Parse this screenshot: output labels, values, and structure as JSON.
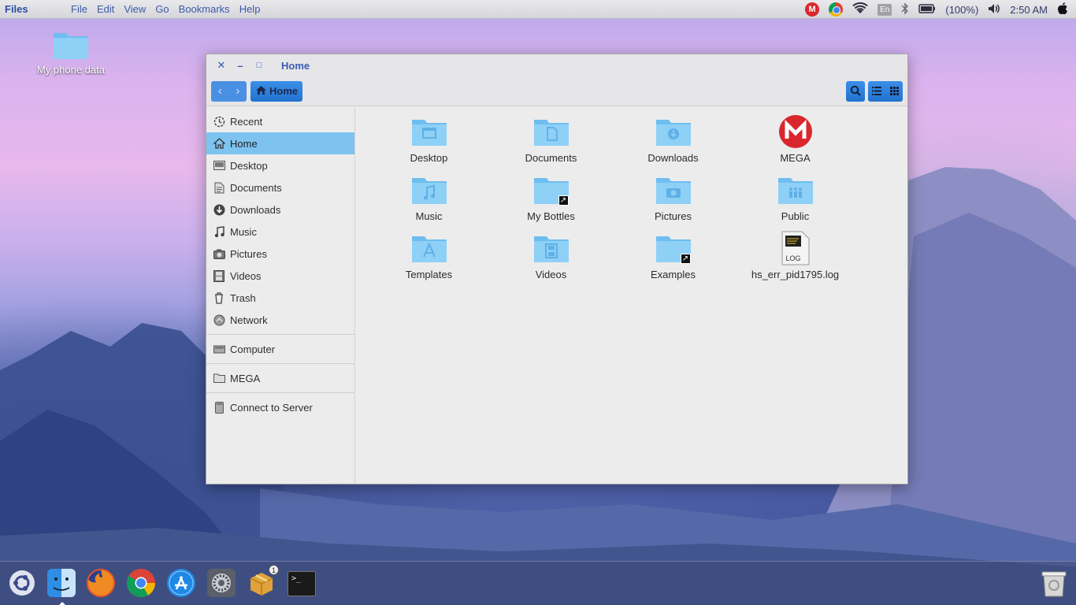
{
  "top_panel": {
    "app_name": "Files",
    "menus": [
      "File",
      "Edit",
      "View",
      "Go",
      "Bookmarks",
      "Help"
    ],
    "tray": {
      "mega_icon": "mega-icon",
      "chrome_icon": "chrome-icon",
      "wifi_icon": "wifi-icon",
      "language": "En",
      "bluetooth_icon": "bluetooth-icon",
      "battery_icon": "battery-icon",
      "battery_text": "(100%)",
      "volume_icon": "volume-icon",
      "clock": "2:50 AM",
      "apple_icon": "apple-icon"
    }
  },
  "desktop": {
    "icons": [
      {
        "label": "My phone data",
        "icon": "folder-icon"
      }
    ]
  },
  "window": {
    "title": "Home",
    "close": "✕",
    "minimize": "–",
    "maximize": "□",
    "breadcrumb": "Home",
    "sidebar": {
      "items": [
        {
          "label": "Recent",
          "icon": "recent-icon"
        },
        {
          "label": "Home",
          "icon": "home-icon",
          "active": true
        },
        {
          "label": "Desktop",
          "icon": "desktop-icon"
        },
        {
          "label": "Documents",
          "icon": "documents-icon"
        },
        {
          "label": "Downloads",
          "icon": "downloads-icon"
        },
        {
          "label": "Music",
          "icon": "music-icon"
        },
        {
          "label": "Pictures",
          "icon": "pictures-icon"
        },
        {
          "label": "Videos",
          "icon": "videos-icon"
        },
        {
          "label": "Trash",
          "icon": "trash-icon"
        },
        {
          "label": "Network",
          "icon": "network-icon"
        }
      ],
      "devices": [
        {
          "label": "Computer",
          "icon": "computer-icon"
        }
      ],
      "bookmarks": [
        {
          "label": "MEGA",
          "icon": "folder-icon"
        }
      ],
      "network": [
        {
          "label": "Connect to Server",
          "icon": "server-icon"
        }
      ]
    },
    "files": [
      {
        "label": "Desktop",
        "icon": "desktop-folder-icon"
      },
      {
        "label": "Documents",
        "icon": "documents-folder-icon"
      },
      {
        "label": "Downloads",
        "icon": "downloads-folder-icon"
      },
      {
        "label": "MEGA",
        "icon": "mega-icon"
      },
      {
        "label": "Music",
        "icon": "music-folder-icon"
      },
      {
        "label": "My Bottles",
        "icon": "folder-link-icon"
      },
      {
        "label": "Pictures",
        "icon": "pictures-folder-icon"
      },
      {
        "label": "Public",
        "icon": "public-folder-icon"
      },
      {
        "label": "Templates",
        "icon": "templates-folder-icon"
      },
      {
        "label": "Videos",
        "icon": "videos-folder-icon"
      },
      {
        "label": "Examples",
        "icon": "folder-link-icon"
      },
      {
        "label": "hs_err_pid1795.log",
        "icon": "log-file-icon",
        "file_badge": "LOG"
      }
    ]
  },
  "dock": {
    "items": [
      {
        "name": "ubuntu-launcher"
      },
      {
        "name": "finder"
      },
      {
        "name": "firefox"
      },
      {
        "name": "chrome"
      },
      {
        "name": "app-store"
      },
      {
        "name": "system-settings"
      },
      {
        "name": "package-installer",
        "badge": "1"
      },
      {
        "name": "terminal"
      },
      {
        "name": "trash"
      }
    ],
    "terminal_prompt": ">_"
  },
  "colors": {
    "accent": "#4a90e2",
    "folder": "#7ec3f0",
    "mega_red": "#d9272e"
  }
}
